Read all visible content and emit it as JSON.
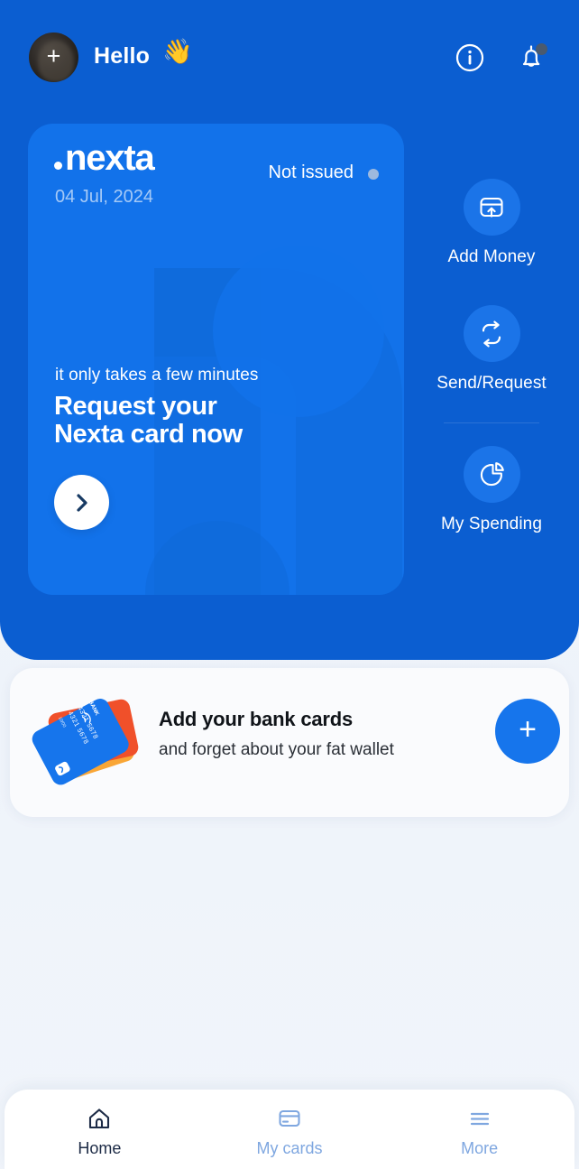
{
  "header": {
    "greeting": "Hello",
    "wave_emoji": "👋",
    "avatar_plus": "+",
    "info_icon": "info-circle-icon",
    "bell_icon": "bell-icon",
    "has_notification": true
  },
  "promo_card": {
    "brand": "nexta",
    "date": "04 Jul, 2024",
    "status": "Not issued",
    "eyebrow": "it only takes a few minutes",
    "title_line1": "Request your",
    "title_line2": "Nexta card now",
    "cta_icon": "chevron-right-icon",
    "bg_color": "#1272ea",
    "status_dot_color": "#9db9de"
  },
  "quick_actions": [
    {
      "label": "Add Money",
      "icon": "add-money-icon"
    },
    {
      "label": "Send/Request",
      "icon": "swap-arrows-icon"
    },
    {
      "label": "My Spending",
      "icon": "pie-chart-icon"
    }
  ],
  "bank_cards_panel": {
    "title": "Add your bank cards",
    "subtitle": "and forget about your fat wallet",
    "add_button_icon": "plus-icon",
    "add_button_label": "+",
    "art": {
      "bank_label": "BANK",
      "card_digits": "4321 5678 4321 5678",
      "expiry": "10/00",
      "colors": {
        "front": "#1675ec",
        "middle": "#f0502a",
        "back": "#f9a636"
      }
    }
  },
  "bottom_nav": [
    {
      "label": "Home",
      "icon": "home-icon",
      "active": true
    },
    {
      "label": "My cards",
      "icon": "card-icon",
      "active": false
    },
    {
      "label": "More",
      "icon": "hamburger-icon",
      "active": false
    }
  ],
  "theme": {
    "hero_blue": "#0b5ed1",
    "accent_blue": "#1675ec",
    "page_bg": "#f1f5fb",
    "nav_active": "#1d2b46",
    "nav_inactive": "#7fa7e0"
  }
}
